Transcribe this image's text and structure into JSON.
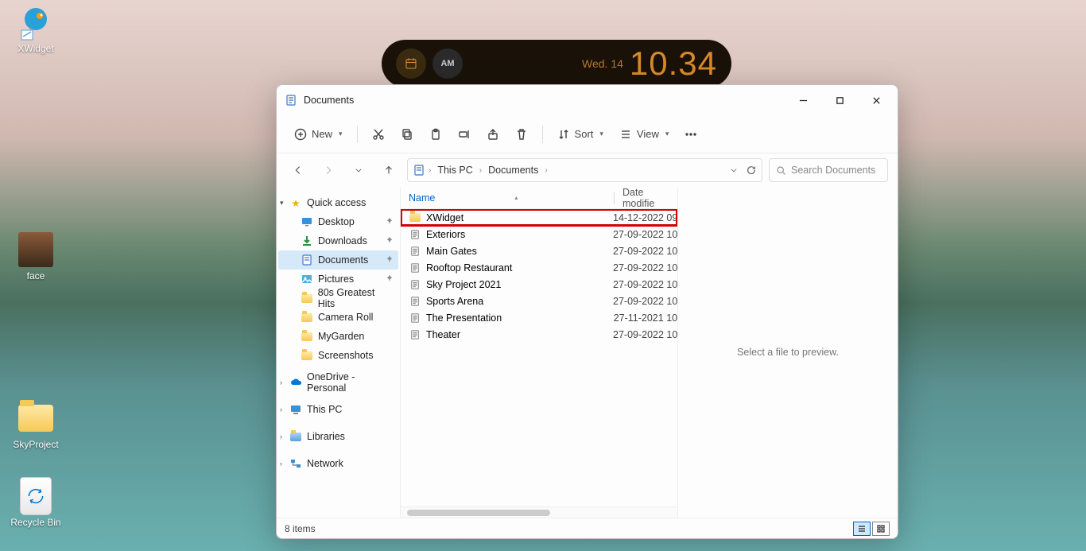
{
  "desktop": {
    "icons": [
      {
        "name": "XWidget"
      },
      {
        "name": "face"
      },
      {
        "name": "SkyProject"
      },
      {
        "name": "Recycle Bin"
      }
    ]
  },
  "clock": {
    "ampm": "AM",
    "date": "Wed. 14",
    "time": "10.34"
  },
  "window": {
    "title": "Documents",
    "toolbar": {
      "new": "New",
      "sort": "Sort",
      "view": "View"
    },
    "breadcrumb": [
      "This PC",
      "Documents"
    ],
    "search_placeholder": "Search Documents",
    "sidebar": {
      "quick_access": "Quick access",
      "items": [
        {
          "label": "Desktop",
          "pinned": true
        },
        {
          "label": "Downloads",
          "pinned": true
        },
        {
          "label": "Documents",
          "pinned": true,
          "selected": true
        },
        {
          "label": "Pictures",
          "pinned": true
        },
        {
          "label": "80s Greatest Hits"
        },
        {
          "label": "Camera Roll"
        },
        {
          "label": "MyGarden"
        },
        {
          "label": "Screenshots"
        }
      ],
      "onedrive": "OneDrive - Personal",
      "thispc": "This PC",
      "libraries": "Libraries",
      "network": "Network"
    },
    "columns": {
      "name": "Name",
      "date": "Date modifie"
    },
    "files": [
      {
        "name": "XWidget",
        "type": "folder",
        "date": "14-12-2022 09",
        "highlight": true
      },
      {
        "name": "Exteriors",
        "type": "doc",
        "date": "27-09-2022 10"
      },
      {
        "name": "Main Gates",
        "type": "doc",
        "date": "27-09-2022 10"
      },
      {
        "name": "Rooftop Restaurant",
        "type": "doc",
        "date": "27-09-2022 10"
      },
      {
        "name": "Sky Project 2021",
        "type": "doc",
        "date": "27-09-2022 10"
      },
      {
        "name": "Sports Arena",
        "type": "doc",
        "date": "27-09-2022 10"
      },
      {
        "name": "The Presentation",
        "type": "doc",
        "date": "27-11-2021 10"
      },
      {
        "name": "Theater",
        "type": "doc",
        "date": "27-09-2022 10"
      }
    ],
    "preview_msg": "Select a file to preview.",
    "status": "8 items"
  }
}
